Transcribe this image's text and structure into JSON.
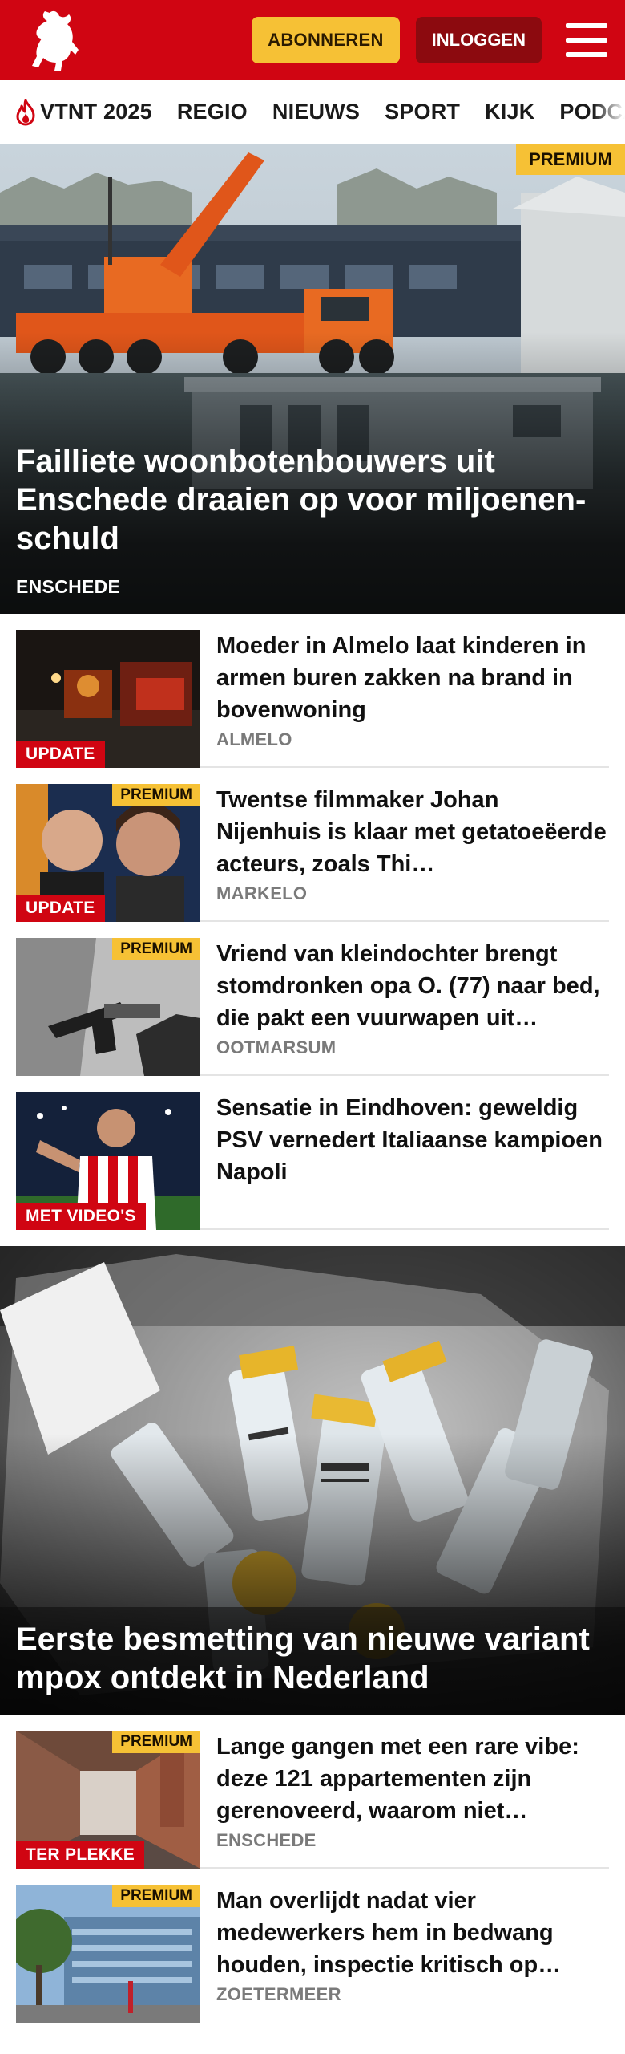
{
  "header": {
    "subscribe_label": "ABONNEREN",
    "login_label": "INLOGGEN",
    "brand_color": "#d00512"
  },
  "nav": {
    "items": [
      "VTNT 2025",
      "REGIO",
      "NIEUWS",
      "SPORT",
      "KIJK",
      "PODCAST"
    ]
  },
  "hero": {
    "badge": "PREMIUM",
    "title": "Failliete woonbotenbouwers uit Enschede draaien op voor miljoenen­schuld",
    "category": "ENSCHEDE"
  },
  "articles": [
    {
      "title": "Moeder in Almelo laat kinderen in armen buren zakken na brand in bovenwoning",
      "category": "ALMELO",
      "label": "UPDATE",
      "premium": ""
    },
    {
      "title": "Twentse filmmaker Johan Nijenhuis is klaar met getatoeëerde acteurs, zoals Thi…",
      "category": "MARKELO",
      "label": "UPDATE",
      "premium": "PREMIUM"
    },
    {
      "title": "Vriend van kleindochter brengt stomdronken opa O. (77) naar bed, die pakt een vuurwapen uit…",
      "category": "OOTMARSUM",
      "label": "",
      "premium": "PREMIUM"
    },
    {
      "title": "Sensatie in Eindhoven: geweldig PSV vernedert Italiaanse kampioen Napoli",
      "category": "",
      "label": "MET VIDEO'S",
      "premium": ""
    }
  ],
  "hero2": {
    "title": "Eerste besmetting van nieuwe variant mpox ontdekt in Nederland"
  },
  "articles2": [
    {
      "title": "Lange gangen met een rare vibe: deze 121 appartementen zijn gerenoveerd, waarom niet…",
      "category": "ENSCHEDE",
      "label": "TER PLEKKE",
      "premium": "PREMIUM"
    },
    {
      "title": "Man overlijdt nadat vier medewerkers hem in bedwang houden, inspectie kritisch op…",
      "category": "ZOETERMEER",
      "label": "",
      "premium": "PREMIUM"
    }
  ]
}
